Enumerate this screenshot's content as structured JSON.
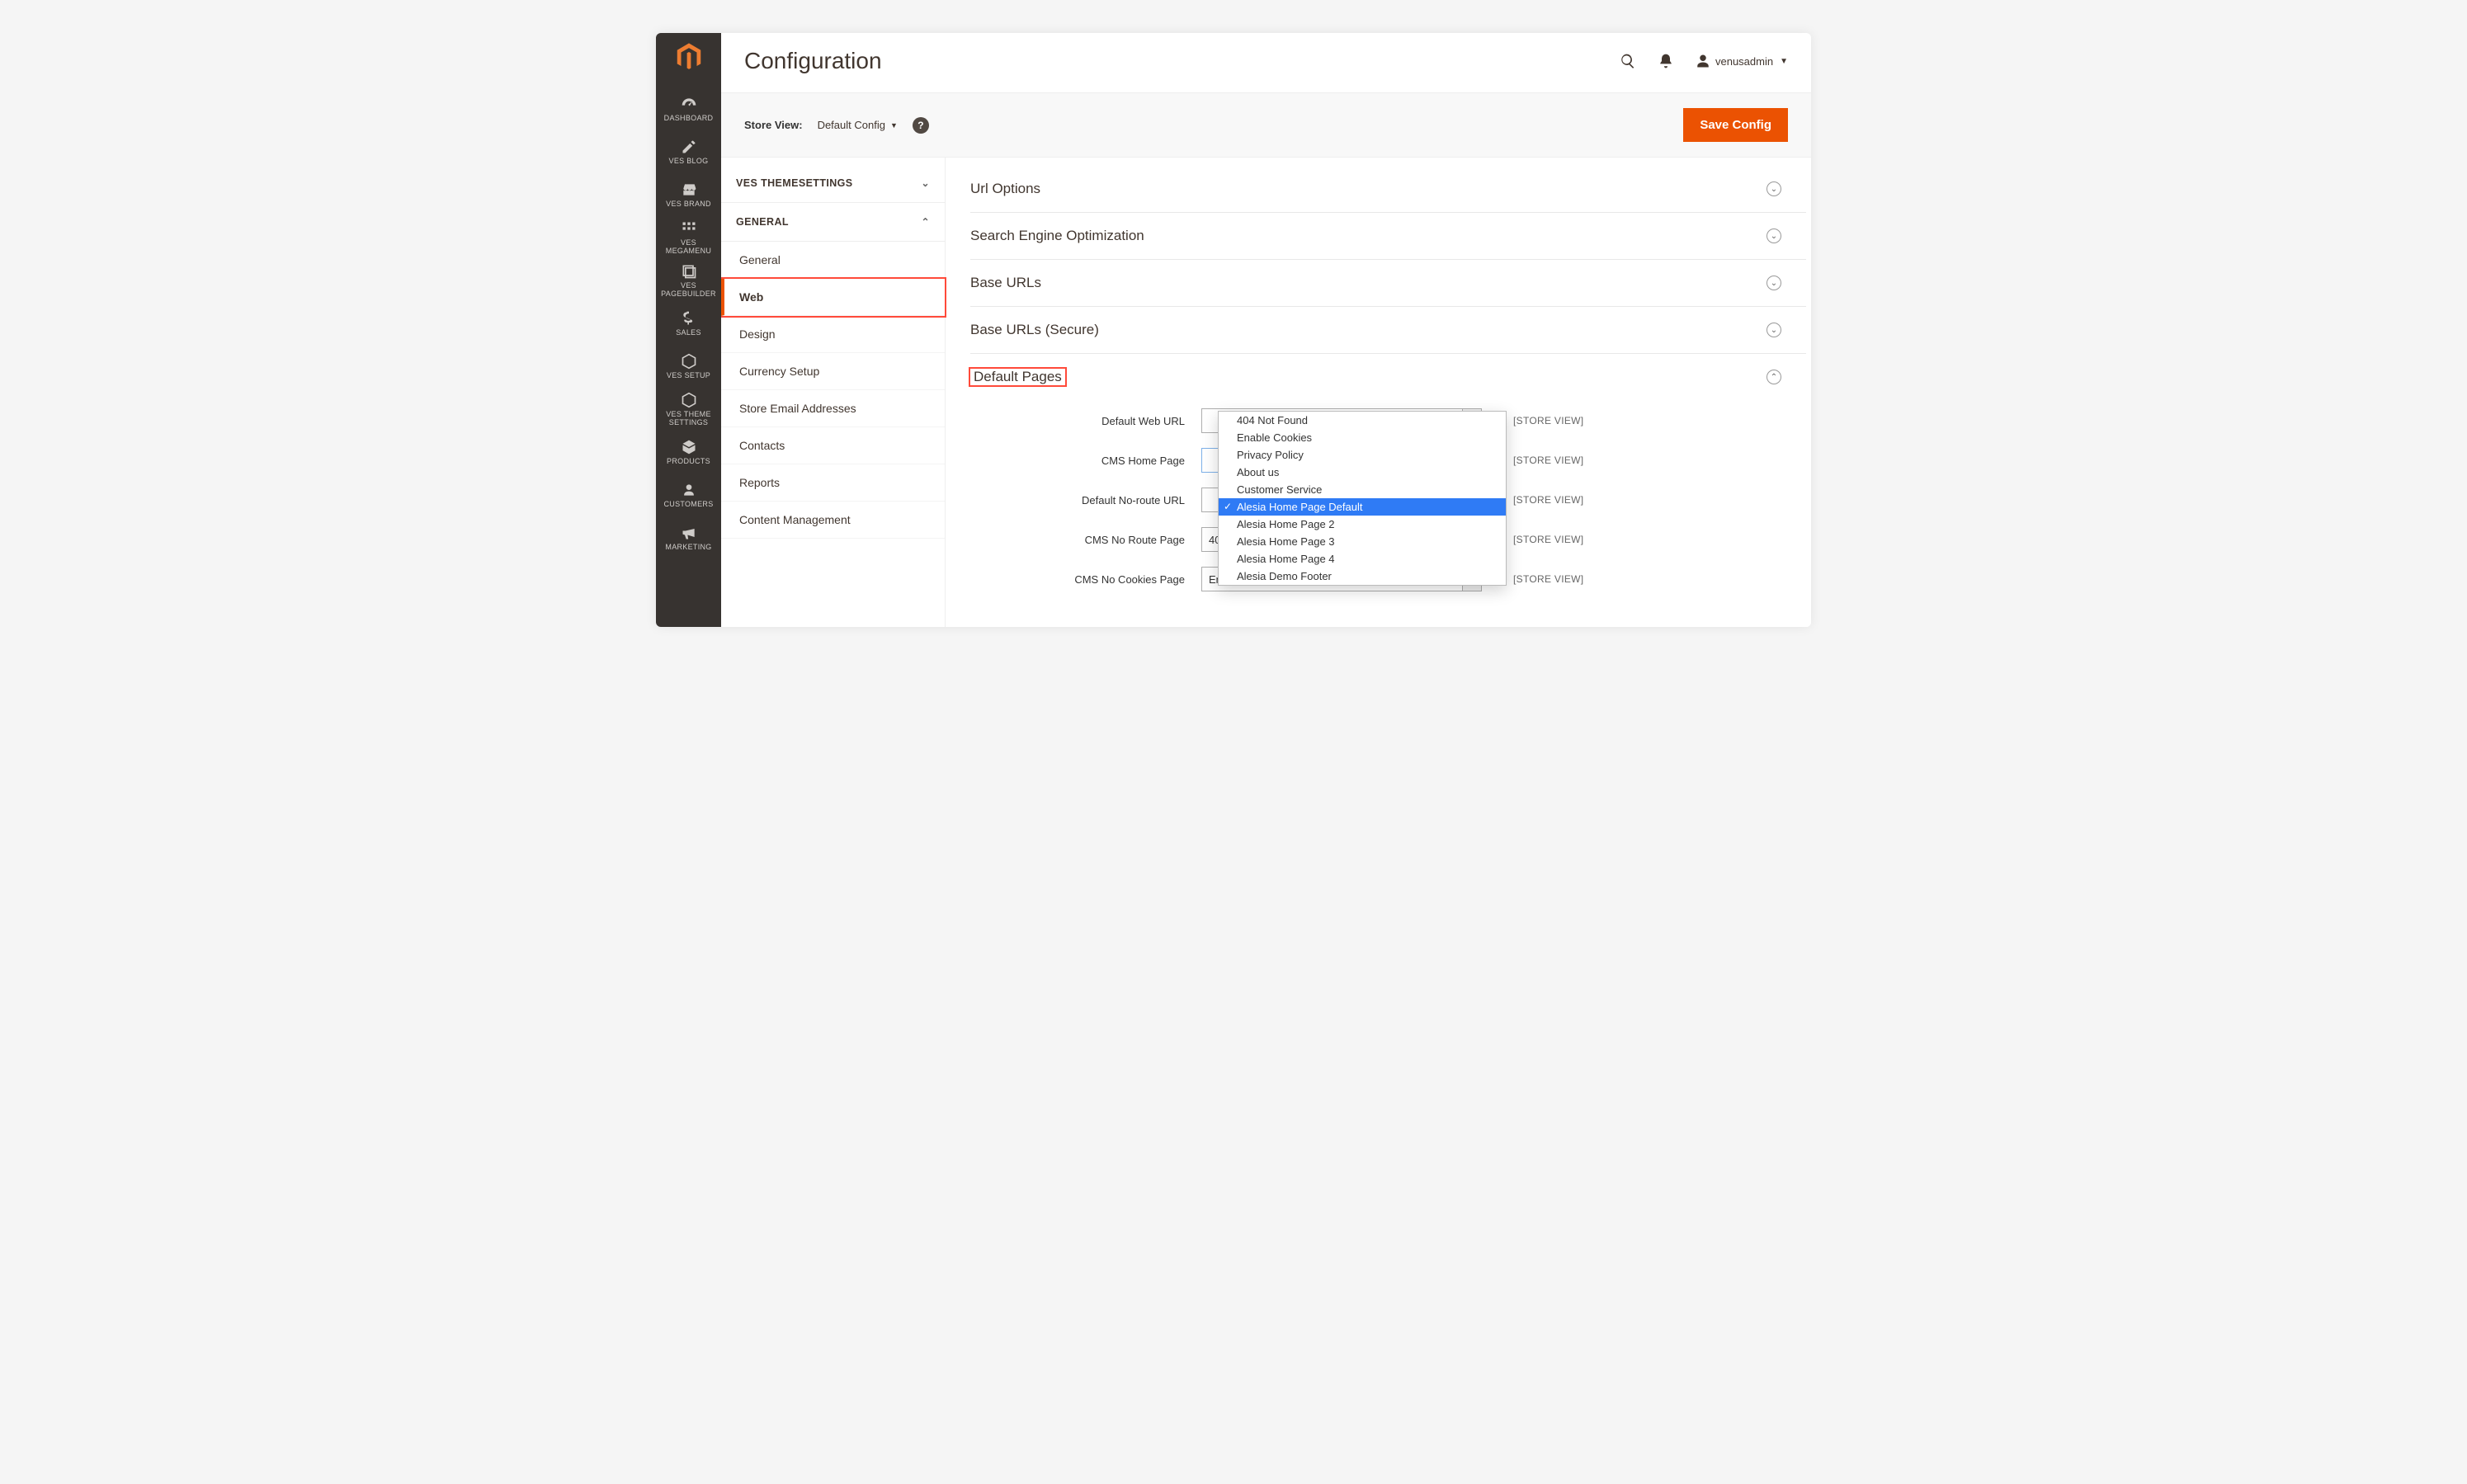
{
  "pageTitle": "Configuration",
  "user": {
    "name": "venusadmin"
  },
  "actionBar": {
    "storeViewLabel": "Store View:",
    "storeViewValue": "Default Config",
    "saveLabel": "Save Config"
  },
  "navRail": [
    {
      "id": "dashboard",
      "label": "DASHBOARD",
      "icon": "gauge"
    },
    {
      "id": "vesblog",
      "label": "VES BLOG",
      "icon": "pencil"
    },
    {
      "id": "vesbrand",
      "label": "VES BRAND",
      "icon": "store"
    },
    {
      "id": "vesmegamenu",
      "label": "VES\nMEGAMENU",
      "icon": "grid"
    },
    {
      "id": "vespagebuilder",
      "label": "VES\nPAGEBUILDER",
      "icon": "layers"
    },
    {
      "id": "sales",
      "label": "SALES",
      "icon": "dollar"
    },
    {
      "id": "vessetup",
      "label": "VES SETUP",
      "icon": "hex"
    },
    {
      "id": "vesthemesettings",
      "label": "VES THEME\nSETTINGS",
      "icon": "hex"
    },
    {
      "id": "products",
      "label": "PRODUCTS",
      "icon": "cube"
    },
    {
      "id": "customers",
      "label": "CUSTOMERS",
      "icon": "person"
    },
    {
      "id": "marketing",
      "label": "MARKETING",
      "icon": "megaphone"
    }
  ],
  "configNav": {
    "cat1": {
      "label": "VES THEMESETTINGS",
      "expanded": false
    },
    "cat2": {
      "label": "GENERAL",
      "expanded": true,
      "items": [
        {
          "id": "general",
          "label": "General"
        },
        {
          "id": "web",
          "label": "Web",
          "active": true
        },
        {
          "id": "design",
          "label": "Design"
        },
        {
          "id": "currency",
          "label": "Currency Setup"
        },
        {
          "id": "email",
          "label": "Store Email Addresses"
        },
        {
          "id": "contacts",
          "label": "Contacts"
        },
        {
          "id": "reports",
          "label": "Reports"
        },
        {
          "id": "content",
          "label": "Content Management"
        }
      ]
    }
  },
  "sections": {
    "s1": "Url Options",
    "s2": "Search Engine Optimization",
    "s3": "Base URLs",
    "s4": "Base URLs (Secure)",
    "s5": "Default Pages"
  },
  "fields": {
    "defaultWebUrl": {
      "label": "Default Web URL",
      "scope": "[STORE VIEW]"
    },
    "cmsHomePage": {
      "label": "CMS Home Page",
      "scope": "[STORE VIEW]"
    },
    "defaultNoRouteUrl": {
      "label": "Default No-route URL",
      "scope": "[STORE VIEW]"
    },
    "cmsNoRoutePage": {
      "label": "CMS No Route Page",
      "value": "404 Not Found",
      "scope": "[STORE VIEW]"
    },
    "cmsNoCookiesPage": {
      "label": "CMS No Cookies Page",
      "value": "Enable Cookies",
      "scope": "[STORE VIEW]"
    }
  },
  "dropdown": {
    "options": [
      "404 Not Found",
      "Enable Cookies",
      "Privacy Policy",
      "About us",
      "Customer Service",
      "Alesia Home Page Default",
      "Alesia Home Page 2",
      "Alesia Home Page 3",
      "Alesia Home Page 4",
      "Alesia Demo Footer"
    ],
    "selected": "Alesia Home Page Default"
  }
}
